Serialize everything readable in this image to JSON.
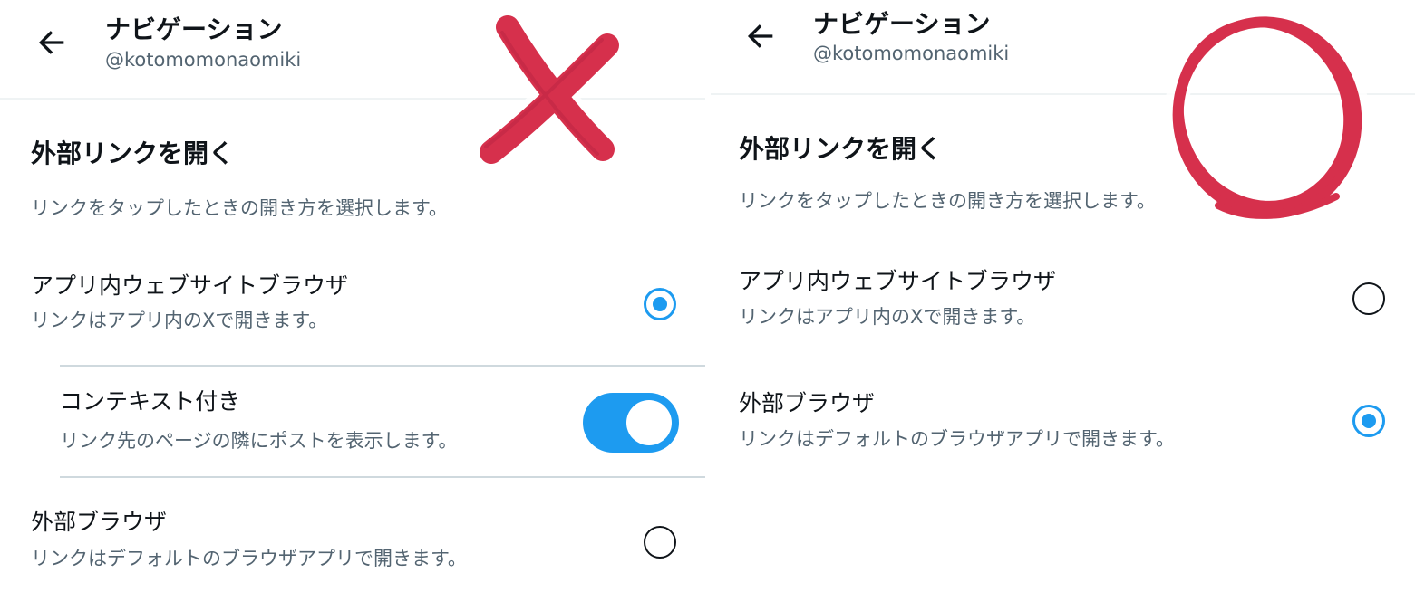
{
  "left_panel": {
    "header": {
      "title": "ナビゲーション",
      "handle": "@kotomomonaomiki"
    },
    "section": {
      "title": "外部リンクを開く",
      "description": "リンクをタップしたときの開き方を選択します。"
    },
    "options": [
      {
        "title": "アプリ内ウェブサイトブラウザ",
        "description": "リンクはアプリ内のXで開きます。",
        "selected": true
      },
      {
        "title": "外部ブラウザ",
        "description": "リンクはデフォルトのブラウザアプリで開きます。",
        "selected": false
      }
    ],
    "sub_option": {
      "title": "コンテキスト付き",
      "description": "リンク先のページの隣にポストを表示します。",
      "enabled": true
    },
    "annotation": "cross-mark"
  },
  "right_panel": {
    "header": {
      "title": "ナビゲーション",
      "handle": "@kotomomonaomiki"
    },
    "section": {
      "title": "外部リンクを開く",
      "description": "リンクをタップしたときの開き方を選択します。"
    },
    "options": [
      {
        "title": "アプリ内ウェブサイトブラウザ",
        "description": "リンクはアプリ内のXで開きます。",
        "selected": false
      },
      {
        "title": "外部ブラウザ",
        "description": "リンクはデフォルトのブラウザアプリで開きます。",
        "selected": true
      }
    ],
    "annotation": "circle-mark"
  },
  "icons": {
    "back": "arrow-left-icon"
  },
  "colors": {
    "accent": "#1d9bf0",
    "text_primary": "#0f1419",
    "text_secondary": "#536471",
    "annotation_red": "#d6304c"
  }
}
